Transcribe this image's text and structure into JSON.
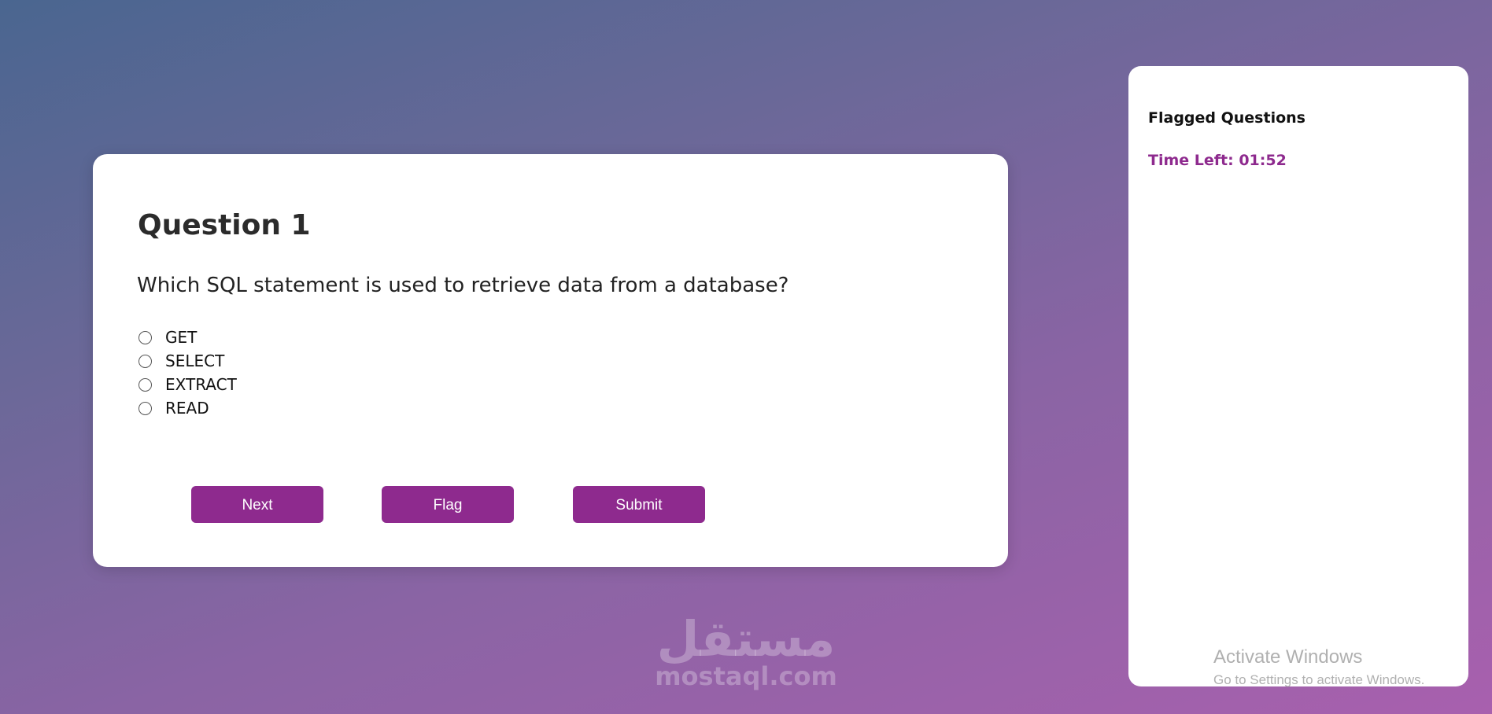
{
  "quiz": {
    "question_title": "Question 1",
    "question_text": "Which SQL statement is used to retrieve data from a database?",
    "options": [
      "GET",
      "SELECT",
      "EXTRACT",
      "READ"
    ],
    "selected_option": null,
    "buttons": {
      "next": "Next",
      "flag": "Flag",
      "submit": "Submit"
    }
  },
  "side_panel": {
    "title": "Flagged Questions",
    "timer": "Time Left: 01:52"
  },
  "watermark": {
    "arabic": "مستقل",
    "latin": "mostaql.com"
  },
  "os_overlay": {
    "title": "Activate Windows",
    "subtitle": "Go to Settings to activate Windows."
  },
  "colors": {
    "accent": "#8e2a8e",
    "card_background": "#ffffff",
    "background_start": "#4a6690",
    "background_end": "#a860ae"
  },
  "icons": {
    "radio": "radio-unchecked-icon"
  }
}
